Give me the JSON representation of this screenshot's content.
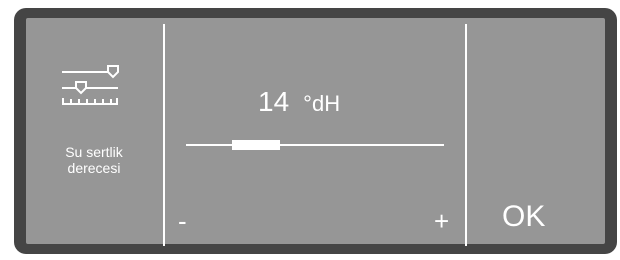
{
  "setting": {
    "icon": "water-hardness-slider-icon",
    "label_line1": "Su sertlik",
    "label_line2": "derecesi"
  },
  "value": {
    "number": "14",
    "unit": "°dH",
    "slider_level_fraction": 0.27
  },
  "controls": {
    "minus_label": "-",
    "plus_label": "+",
    "ok_label": "OK"
  },
  "colors": {
    "bezel": "#454545",
    "screen": "#969696",
    "foreground": "#ffffff"
  }
}
